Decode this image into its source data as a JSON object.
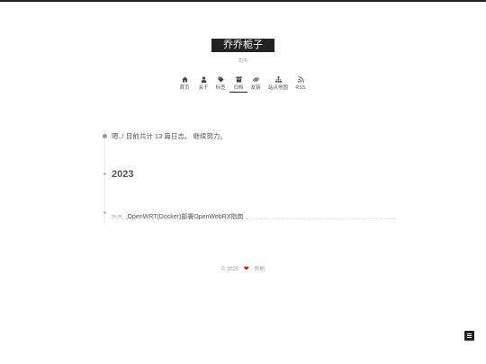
{
  "site": {
    "title": "乔乔栀子",
    "subtitle": "司书"
  },
  "menu": [
    {
      "key": "home",
      "label": "首页",
      "icon": "home-icon"
    },
    {
      "key": "about",
      "label": "关于",
      "icon": "user-icon"
    },
    {
      "key": "tags",
      "label": "标签",
      "icon": "tags-icon"
    },
    {
      "key": "archives",
      "label": "归档",
      "icon": "archive-icon",
      "active": true
    },
    {
      "key": "links",
      "label": "友链",
      "icon": "link-icon"
    },
    {
      "key": "sitemap",
      "label": "站点地图",
      "icon": "sitemap-icon"
    },
    {
      "key": "rss",
      "label": "RSS",
      "icon": "rss-icon"
    }
  ],
  "archive": {
    "cheer": "嗯..! 目前共计 13 篇日志。 继续努力。",
    "year": "2023",
    "posts": [
      {
        "date": "05-08",
        "title": "OpenWRT(Docker)部署OpenWebRX指南"
      }
    ]
  },
  "footer": {
    "copyright": "© 2025",
    "author": "乔栀",
    "heart_color": "#ff0000",
    "heart_icon": "heart-icon"
  },
  "side_button_icon": "menu-icon"
}
